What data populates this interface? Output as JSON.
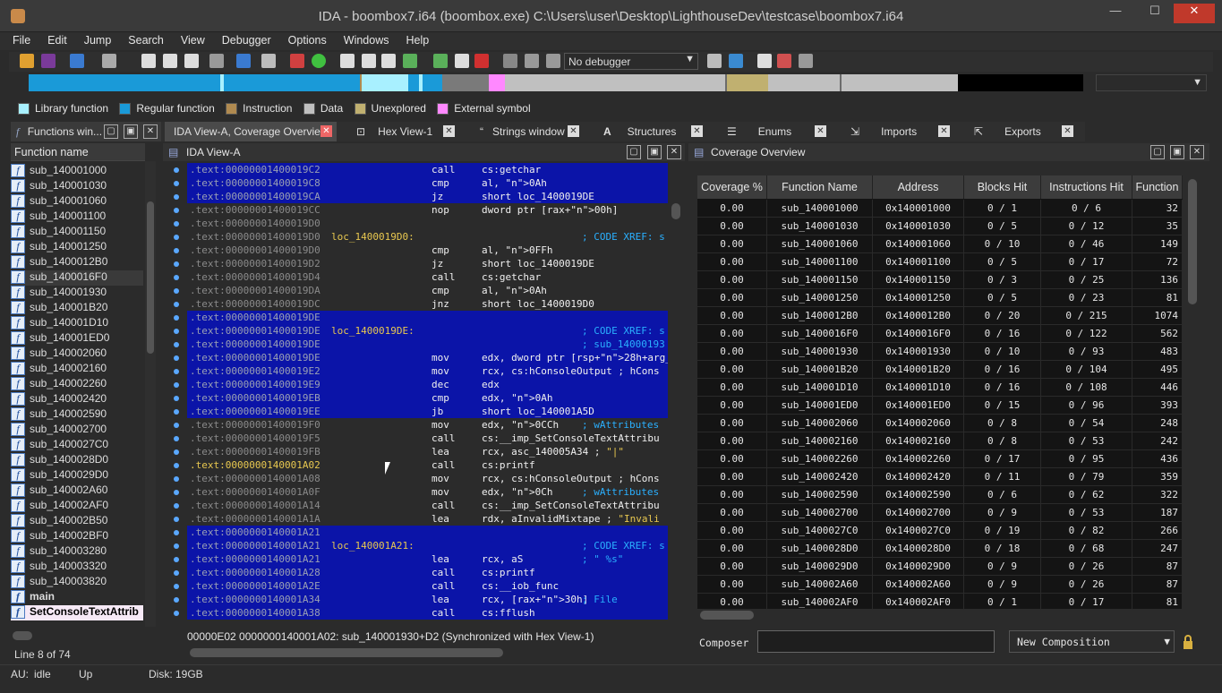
{
  "window": {
    "title": "IDA - boombox7.i64 (boombox.exe) C:\\Users\\user\\Desktop\\LighthouseDev\\testcase\\boombox7.i64",
    "minimize": "—",
    "maximize": "☐",
    "close": "✕"
  },
  "menu": [
    "File",
    "Edit",
    "Jump",
    "Search",
    "View",
    "Debugger",
    "Options",
    "Windows",
    "Help"
  ],
  "toolbar": {
    "debugger_select": "No debugger"
  },
  "legend": [
    {
      "label": "Library function",
      "color": "#a8f0ff"
    },
    {
      "label": "Regular function",
      "color": "#1a9ad8"
    },
    {
      "label": "Instruction",
      "color": "#b08a50"
    },
    {
      "label": "Data",
      "color": "#c0c0c0"
    },
    {
      "label": "Unexplored",
      "color": "#c0b070"
    },
    {
      "label": "External symbol",
      "color": "#ff88ff"
    }
  ],
  "tabs": [
    "Functions win...",
    "IDA View-A, Coverage Overview",
    "Hex View-1",
    "Strings window",
    "Structures",
    "Enums",
    "Imports",
    "Exports"
  ],
  "functions": {
    "header": "Function name",
    "items": [
      "sub_140001000",
      "sub_140001030",
      "sub_140001060",
      "sub_140001100",
      "sub_140001150",
      "sub_140001250",
      "sub_1400012B0",
      "sub_1400016F0",
      "sub_140001930",
      "sub_140001B20",
      "sub_140001D10",
      "sub_140001ED0",
      "sub_140002060",
      "sub_140002160",
      "sub_140002260",
      "sub_140002420",
      "sub_140002590",
      "sub_140002700",
      "sub_1400027C0",
      "sub_1400028D0",
      "sub_1400029D0",
      "sub_140002A60",
      "sub_140002AF0",
      "sub_140002B50",
      "sub_140002BF0",
      "sub_140003280",
      "sub_140003320",
      "sub_140003820",
      "main",
      "SetConsoleTextAttrib"
    ],
    "status": "Line 8 of 74"
  },
  "ida_view": {
    "title": "IDA View-A",
    "status": "00000E02  0000000140001A02: sub_140001930+D2  (Synchronized with Hex View-1)",
    "lines": [
      {
        "addr": ".text:00000001400019C2",
        "label": "",
        "mnem": "call",
        "op": "cs:getchar",
        "cmt": "",
        "blue": true
      },
      {
        "addr": ".text:00000001400019C8",
        "label": "",
        "mnem": "cmp",
        "op": "al, 0Ah",
        "cmt": "",
        "blue": true
      },
      {
        "addr": ".text:00000001400019CA",
        "label": "",
        "mnem": "jz",
        "op": "short loc_1400019DE",
        "cmt": "",
        "blue": true
      },
      {
        "addr": ".text:00000001400019CC",
        "label": "",
        "mnem": "nop",
        "op": "dword ptr [rax+00h]",
        "cmt": "",
        "blue": false
      },
      {
        "addr": ".text:00000001400019D0",
        "label": "",
        "mnem": "",
        "op": "",
        "cmt": "",
        "blue": false
      },
      {
        "addr": ".text:00000001400019D0",
        "label": "loc_1400019D0:",
        "mnem": "",
        "op": "",
        "cmt": "; CODE XREF: s",
        "blue": false
      },
      {
        "addr": ".text:00000001400019D0",
        "label": "",
        "mnem": "cmp",
        "op": "al, 0FFh",
        "cmt": "",
        "blue": false
      },
      {
        "addr": ".text:00000001400019D2",
        "label": "",
        "mnem": "jz",
        "op": "short loc_1400019DE",
        "cmt": "",
        "blue": false
      },
      {
        "addr": ".text:00000001400019D4",
        "label": "",
        "mnem": "call",
        "op": "cs:getchar",
        "cmt": "",
        "blue": false
      },
      {
        "addr": ".text:00000001400019DA",
        "label": "",
        "mnem": "cmp",
        "op": "al, 0Ah",
        "cmt": "",
        "blue": false
      },
      {
        "addr": ".text:00000001400019DC",
        "label": "",
        "mnem": "jnz",
        "op": "short loc_1400019D0",
        "cmt": "",
        "blue": false
      },
      {
        "addr": ".text:00000001400019DE",
        "label": "",
        "mnem": "",
        "op": "",
        "cmt": "",
        "blue": true
      },
      {
        "addr": ".text:00000001400019DE",
        "label": "loc_1400019DE:",
        "mnem": "",
        "op": "",
        "cmt": "; CODE XREF: s",
        "blue": true
      },
      {
        "addr": ".text:00000001400019DE",
        "label": "",
        "mnem": "",
        "op": "",
        "cmt": "; sub_14000193",
        "blue": true
      },
      {
        "addr": ".text:00000001400019DE",
        "label": "",
        "mnem": "mov",
        "op": "edx, dword ptr [rsp+28h+arg_8]",
        "cmt": "",
        "blue": true
      },
      {
        "addr": ".text:00000001400019E2",
        "label": "",
        "mnem": "mov",
        "op": "rcx, cs:hConsoleOutput ; hCons",
        "cmt": "",
        "blue": true
      },
      {
        "addr": ".text:00000001400019E9",
        "label": "",
        "mnem": "dec",
        "op": "edx",
        "cmt": "",
        "blue": true
      },
      {
        "addr": ".text:00000001400019EB",
        "label": "",
        "mnem": "cmp",
        "op": "edx, 0Ah",
        "cmt": "",
        "blue": true
      },
      {
        "addr": ".text:00000001400019EE",
        "label": "",
        "mnem": "jb",
        "op": "short loc_140001A5D",
        "cmt": "",
        "blue": true
      },
      {
        "addr": ".text:00000001400019F0",
        "label": "",
        "mnem": "mov",
        "op": "edx, 0CCh",
        "cmt": "; wAttributes",
        "blue": false
      },
      {
        "addr": ".text:00000001400019F5",
        "label": "",
        "mnem": "call",
        "op": "cs:__imp_SetConsoleTextAttribu",
        "cmt": "",
        "blue": false
      },
      {
        "addr": ".text:00000001400019FB",
        "label": "",
        "mnem": "lea",
        "op": "rcx, asc_140005A34 ; \"|\"",
        "cmt": "",
        "blue": false
      },
      {
        "addr": ".text:0000000140001A02",
        "label": "",
        "mnem": "call",
        "op": "cs:printf",
        "cmt": "",
        "blue": false,
        "cur": true
      },
      {
        "addr": ".text:0000000140001A08",
        "label": "",
        "mnem": "mov",
        "op": "rcx, cs:hConsoleOutput ; hCons",
        "cmt": "",
        "blue": false
      },
      {
        "addr": ".text:0000000140001A0F",
        "label": "",
        "mnem": "mov",
        "op": "edx, 0Ch",
        "cmt": "; wAttributes",
        "blue": false
      },
      {
        "addr": ".text:0000000140001A14",
        "label": "",
        "mnem": "call",
        "op": "cs:__imp_SetConsoleTextAttribu",
        "cmt": "",
        "blue": false
      },
      {
        "addr": ".text:0000000140001A1A",
        "label": "",
        "mnem": "lea",
        "op": "rdx, aInvalidMixtape ; \"Invali",
        "cmt": "",
        "blue": false
      },
      {
        "addr": ".text:0000000140001A21",
        "label": "",
        "mnem": "",
        "op": "",
        "cmt": "",
        "blue": true
      },
      {
        "addr": ".text:0000000140001A21",
        "label": "loc_140001A21:",
        "mnem": "",
        "op": "",
        "cmt": "; CODE XREF: s",
        "blue": true
      },
      {
        "addr": ".text:0000000140001A21",
        "label": "",
        "mnem": "lea",
        "op": "rcx, aS",
        "cmt": "; \" %s\"",
        "blue": true
      },
      {
        "addr": ".text:0000000140001A28",
        "label": "",
        "mnem": "call",
        "op": "cs:printf",
        "cmt": "",
        "blue": true
      },
      {
        "addr": ".text:0000000140001A2E",
        "label": "",
        "mnem": "call",
        "op": "cs:__iob_func",
        "cmt": "",
        "blue": true
      },
      {
        "addr": ".text:0000000140001A34",
        "label": "",
        "mnem": "lea",
        "op": "rcx, [rax+30h]",
        "cmt": "; File",
        "blue": true
      },
      {
        "addr": ".text:0000000140001A38",
        "label": "",
        "mnem": "call",
        "op": "cs:fflush",
        "cmt": "",
        "blue": true
      }
    ]
  },
  "coverage": {
    "title": "Coverage Overview",
    "columns": [
      "Coverage %",
      "Function Name",
      "Address",
      "Blocks Hit",
      "Instructions Hit",
      "Function"
    ],
    "rows": [
      [
        "0.00",
        "sub_140001000",
        "0x140001000",
        "0 / 1",
        "0 / 6",
        "32"
      ],
      [
        "0.00",
        "sub_140001030",
        "0x140001030",
        "0 / 5",
        "0 / 12",
        "35"
      ],
      [
        "0.00",
        "sub_140001060",
        "0x140001060",
        "0 / 10",
        "0 / 46",
        "149"
      ],
      [
        "0.00",
        "sub_140001100",
        "0x140001100",
        "0 / 5",
        "0 / 17",
        "72"
      ],
      [
        "0.00",
        "sub_140001150",
        "0x140001150",
        "0 / 3",
        "0 / 25",
        "136"
      ],
      [
        "0.00",
        "sub_140001250",
        "0x140001250",
        "0 / 5",
        "0 / 23",
        "81"
      ],
      [
        "0.00",
        "sub_1400012B0",
        "0x1400012B0",
        "0 / 20",
        "0 / 215",
        "1074"
      ],
      [
        "0.00",
        "sub_1400016F0",
        "0x1400016F0",
        "0 / 16",
        "0 / 122",
        "562"
      ],
      [
        "0.00",
        "sub_140001930",
        "0x140001930",
        "0 / 10",
        "0 / 93",
        "483"
      ],
      [
        "0.00",
        "sub_140001B20",
        "0x140001B20",
        "0 / 16",
        "0 / 104",
        "495"
      ],
      [
        "0.00",
        "sub_140001D10",
        "0x140001D10",
        "0 / 16",
        "0 / 108",
        "446"
      ],
      [
        "0.00",
        "sub_140001ED0",
        "0x140001ED0",
        "0 / 15",
        "0 / 96",
        "393"
      ],
      [
        "0.00",
        "sub_140002060",
        "0x140002060",
        "0 / 8",
        "0 / 54",
        "248"
      ],
      [
        "0.00",
        "sub_140002160",
        "0x140002160",
        "0 / 8",
        "0 / 53",
        "242"
      ],
      [
        "0.00",
        "sub_140002260",
        "0x140002260",
        "0 / 17",
        "0 / 95",
        "436"
      ],
      [
        "0.00",
        "sub_140002420",
        "0x140002420",
        "0 / 11",
        "0 / 79",
        "359"
      ],
      [
        "0.00",
        "sub_140002590",
        "0x140002590",
        "0 / 6",
        "0 / 62",
        "322"
      ],
      [
        "0.00",
        "sub_140002700",
        "0x140002700",
        "0 / 9",
        "0 / 53",
        "187"
      ],
      [
        "0.00",
        "sub_1400027C0",
        "0x1400027C0",
        "0 / 19",
        "0 / 82",
        "266"
      ],
      [
        "0.00",
        "sub_1400028D0",
        "0x1400028D0",
        "0 / 18",
        "0 / 68",
        "247"
      ],
      [
        "0.00",
        "sub_1400029D0",
        "0x1400029D0",
        "0 / 9",
        "0 / 26",
        "87"
      ],
      [
        "0.00",
        "sub_140002A60",
        "0x140002A60",
        "0 / 9",
        "0 / 26",
        "87"
      ],
      [
        "0.00",
        "sub_140002AF0",
        "0x140002AF0",
        "0 / 1",
        "0 / 17",
        "81"
      ]
    ],
    "composer_label": "Composer",
    "composer_value": "",
    "composition_select": "New Composition"
  },
  "statusbar": {
    "au": "AU:",
    "au_state": "idle",
    "dir": "Up",
    "disk": "Disk: 19GB"
  }
}
